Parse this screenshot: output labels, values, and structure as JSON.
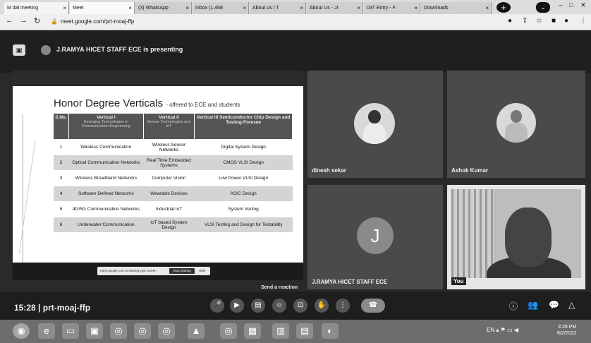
{
  "browser": {
    "tabs": [
      {
        "label": "M dal meeting"
      },
      {
        "label": "Meet"
      },
      {
        "label": "(3) WhatsApp"
      },
      {
        "label": "Inbox (1,468"
      },
      {
        "label": "About us | T"
      },
      {
        "label": "About Us - Jr"
      },
      {
        "label": "03T Entry - F"
      },
      {
        "label": "Downloads"
      }
    ],
    "url": "meet.google.com/prt-moaj-ffp"
  },
  "presenting_banner": "J.RAMYA HICET STAFF ECE is presenting",
  "slide": {
    "title": "Honor Degree Verticals",
    "subtitle": "- offered to ECE and students",
    "headers": [
      "S.No.",
      "Vertical I",
      "Vertical II",
      "Vertical III Semiconductor Chip Design and Testing-Foresee"
    ],
    "header_sub": [
      "",
      "Emerging Technologies in Communication Engineering",
      "Sensor Technologies and IoT",
      ""
    ],
    "rows": [
      [
        "1",
        "Wireless Communication",
        "Wireless Sensor Networks",
        "Digital System Design"
      ],
      [
        "2",
        "Optical Communication Networks",
        "Real Time Embedded Systems",
        "CMOS VLSI Design"
      ],
      [
        "3",
        "Wireless Broadband Networks",
        "Computer Vision",
        "Low Power VLSI Design"
      ],
      [
        "4",
        "Software Defined Networks",
        "Wearable Devices",
        "ASIC Design"
      ],
      [
        "5",
        "4G/5G Communication Networks",
        "Industrial IoT",
        "System Verilog"
      ],
      [
        "6",
        "Underwater Communication",
        "IoT based System Design",
        "VLSI Testing and Design for Testability"
      ]
    ],
    "share_bar": {
      "text": "meet.google.com is sharing your screen",
      "stop": "Stop sharing",
      "hide": "Hide"
    }
  },
  "participants": [
    {
      "name": "dinesh sekar"
    },
    {
      "name": "Ashok Kumar"
    },
    {
      "name": "J.RAMYA HICET STAFF ECE",
      "initial": "J"
    },
    {
      "name": "You"
    }
  ],
  "send_tip": "Send a reaction",
  "meeting": {
    "time": "15:28",
    "separator": "|",
    "code": "prt-moaj-ffp"
  },
  "clock": {
    "time": "3:28 PM",
    "date": "8/2/2022"
  },
  "tray_lang": "EN"
}
